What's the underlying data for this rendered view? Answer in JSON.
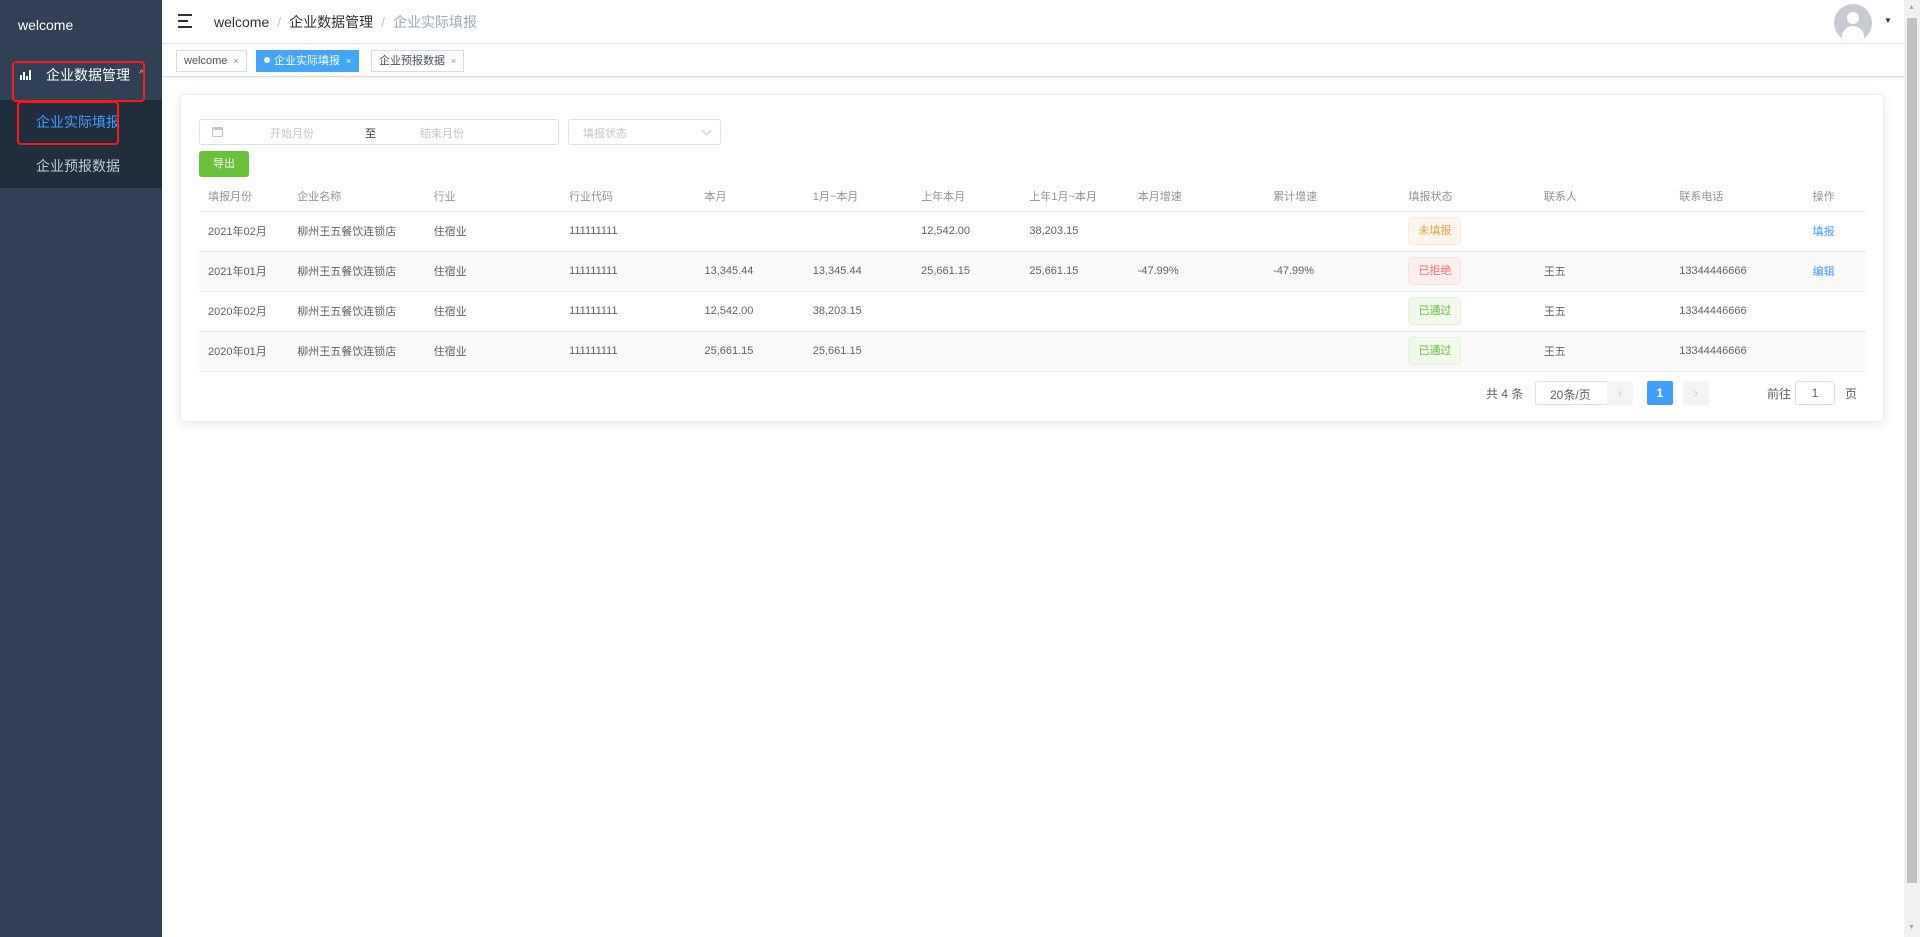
{
  "sidebar": {
    "logo": "welcome",
    "group": {
      "label": "企业数据管理",
      "icon": "bar-chart-icon"
    },
    "items": [
      {
        "label": "企业实际填报",
        "active": true
      },
      {
        "label": "企业预报数据",
        "active": false
      }
    ]
  },
  "header": {
    "breadcrumb": [
      "welcome",
      "企业数据管理",
      "企业实际填报"
    ],
    "separator": "/"
  },
  "tags": [
    {
      "label": "welcome",
      "active": false
    },
    {
      "label": "企业实际填报",
      "active": true
    },
    {
      "label": "企业预报数据",
      "active": false
    }
  ],
  "filters": {
    "start_placeholder": "开始月份",
    "range_separator": "至",
    "end_placeholder": "结束月份",
    "status_placeholder": "填报状态",
    "export_label": "导出"
  },
  "table": {
    "columns": [
      "填报月份",
      "企业名称",
      "行业",
      "行业代码",
      "本月",
      "1月~本月",
      "上年本月",
      "上年1月~本月",
      "本月增速",
      "累计增速",
      "填报状态",
      "联系人",
      "联系电话",
      "操作"
    ],
    "rows": [
      [
        "2021年02月",
        "柳州王五餐饮连锁店",
        "住宿业",
        "111111111",
        "",
        "",
        "12,542.00",
        "38,203.15",
        "",
        "",
        "未填报",
        "",
        "",
        "填报"
      ],
      [
        "2021年01月",
        "柳州王五餐饮连锁店",
        "住宿业",
        "111111111",
        "13,345.44",
        "13,345.44",
        "25,661.15",
        "25,661.15",
        "-47.99%",
        "-47.99%",
        "已拒绝",
        "王五",
        "13344446666",
        "编辑"
      ],
      [
        "2020年02月",
        "柳州王五餐饮连锁店",
        "住宿业",
        "111111111",
        "12,542.00",
        "38,203.15",
        "",
        "",
        "",
        "",
        "已通过",
        "王五",
        "13344446666",
        ""
      ],
      [
        "2020年01月",
        "柳州王五餐饮连锁店",
        "住宿业",
        "111111111",
        "25,661.15",
        "25,661.15",
        "",
        "",
        "",
        "",
        "已通过",
        "王五",
        "13344446666",
        ""
      ]
    ],
    "status_types": [
      "warn",
      "danger",
      "ok",
      "ok"
    ]
  },
  "pagination": {
    "total": "共 4 条",
    "page_size": "20条/页",
    "current_page": "1",
    "goto_label": "前往",
    "goto_value": "1",
    "page_suffix": "页"
  },
  "colors": {
    "sidebar_bg": "#304156",
    "active": "#409eff",
    "export": "#67c23a",
    "highlight_box": "#ff1a1a"
  }
}
